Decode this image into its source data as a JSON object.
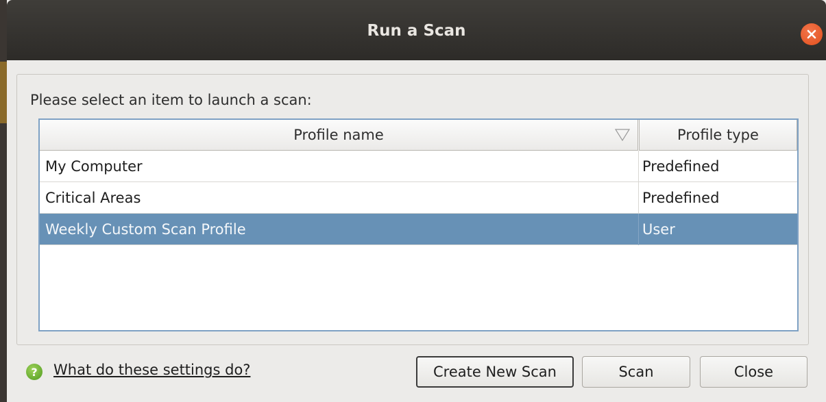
{
  "dialog": {
    "title": "Run a Scan",
    "prompt": "Please select an item to launch a scan:"
  },
  "table": {
    "columns": [
      "Profile name",
      "Profile type"
    ],
    "rows": [
      {
        "name": "My Computer",
        "type": "Predefined",
        "selected": false
      },
      {
        "name": "Critical Areas",
        "type": "Predefined",
        "selected": false
      },
      {
        "name": "Weekly Custom Scan Profile",
        "type": "User",
        "selected": true
      }
    ]
  },
  "footer": {
    "help_link": "What do these settings do?",
    "create_button": "Create New Scan",
    "scan_button": "Scan",
    "close_button": "Close"
  },
  "colors": {
    "titlebar": "#2d2b28",
    "close_button": "#e2501d",
    "selection": "#6791b6",
    "help_icon": "#4e9a1e"
  },
  "icons": {
    "close": "close-icon",
    "sort": "sort-indicator-icon",
    "help": "help-icon"
  }
}
